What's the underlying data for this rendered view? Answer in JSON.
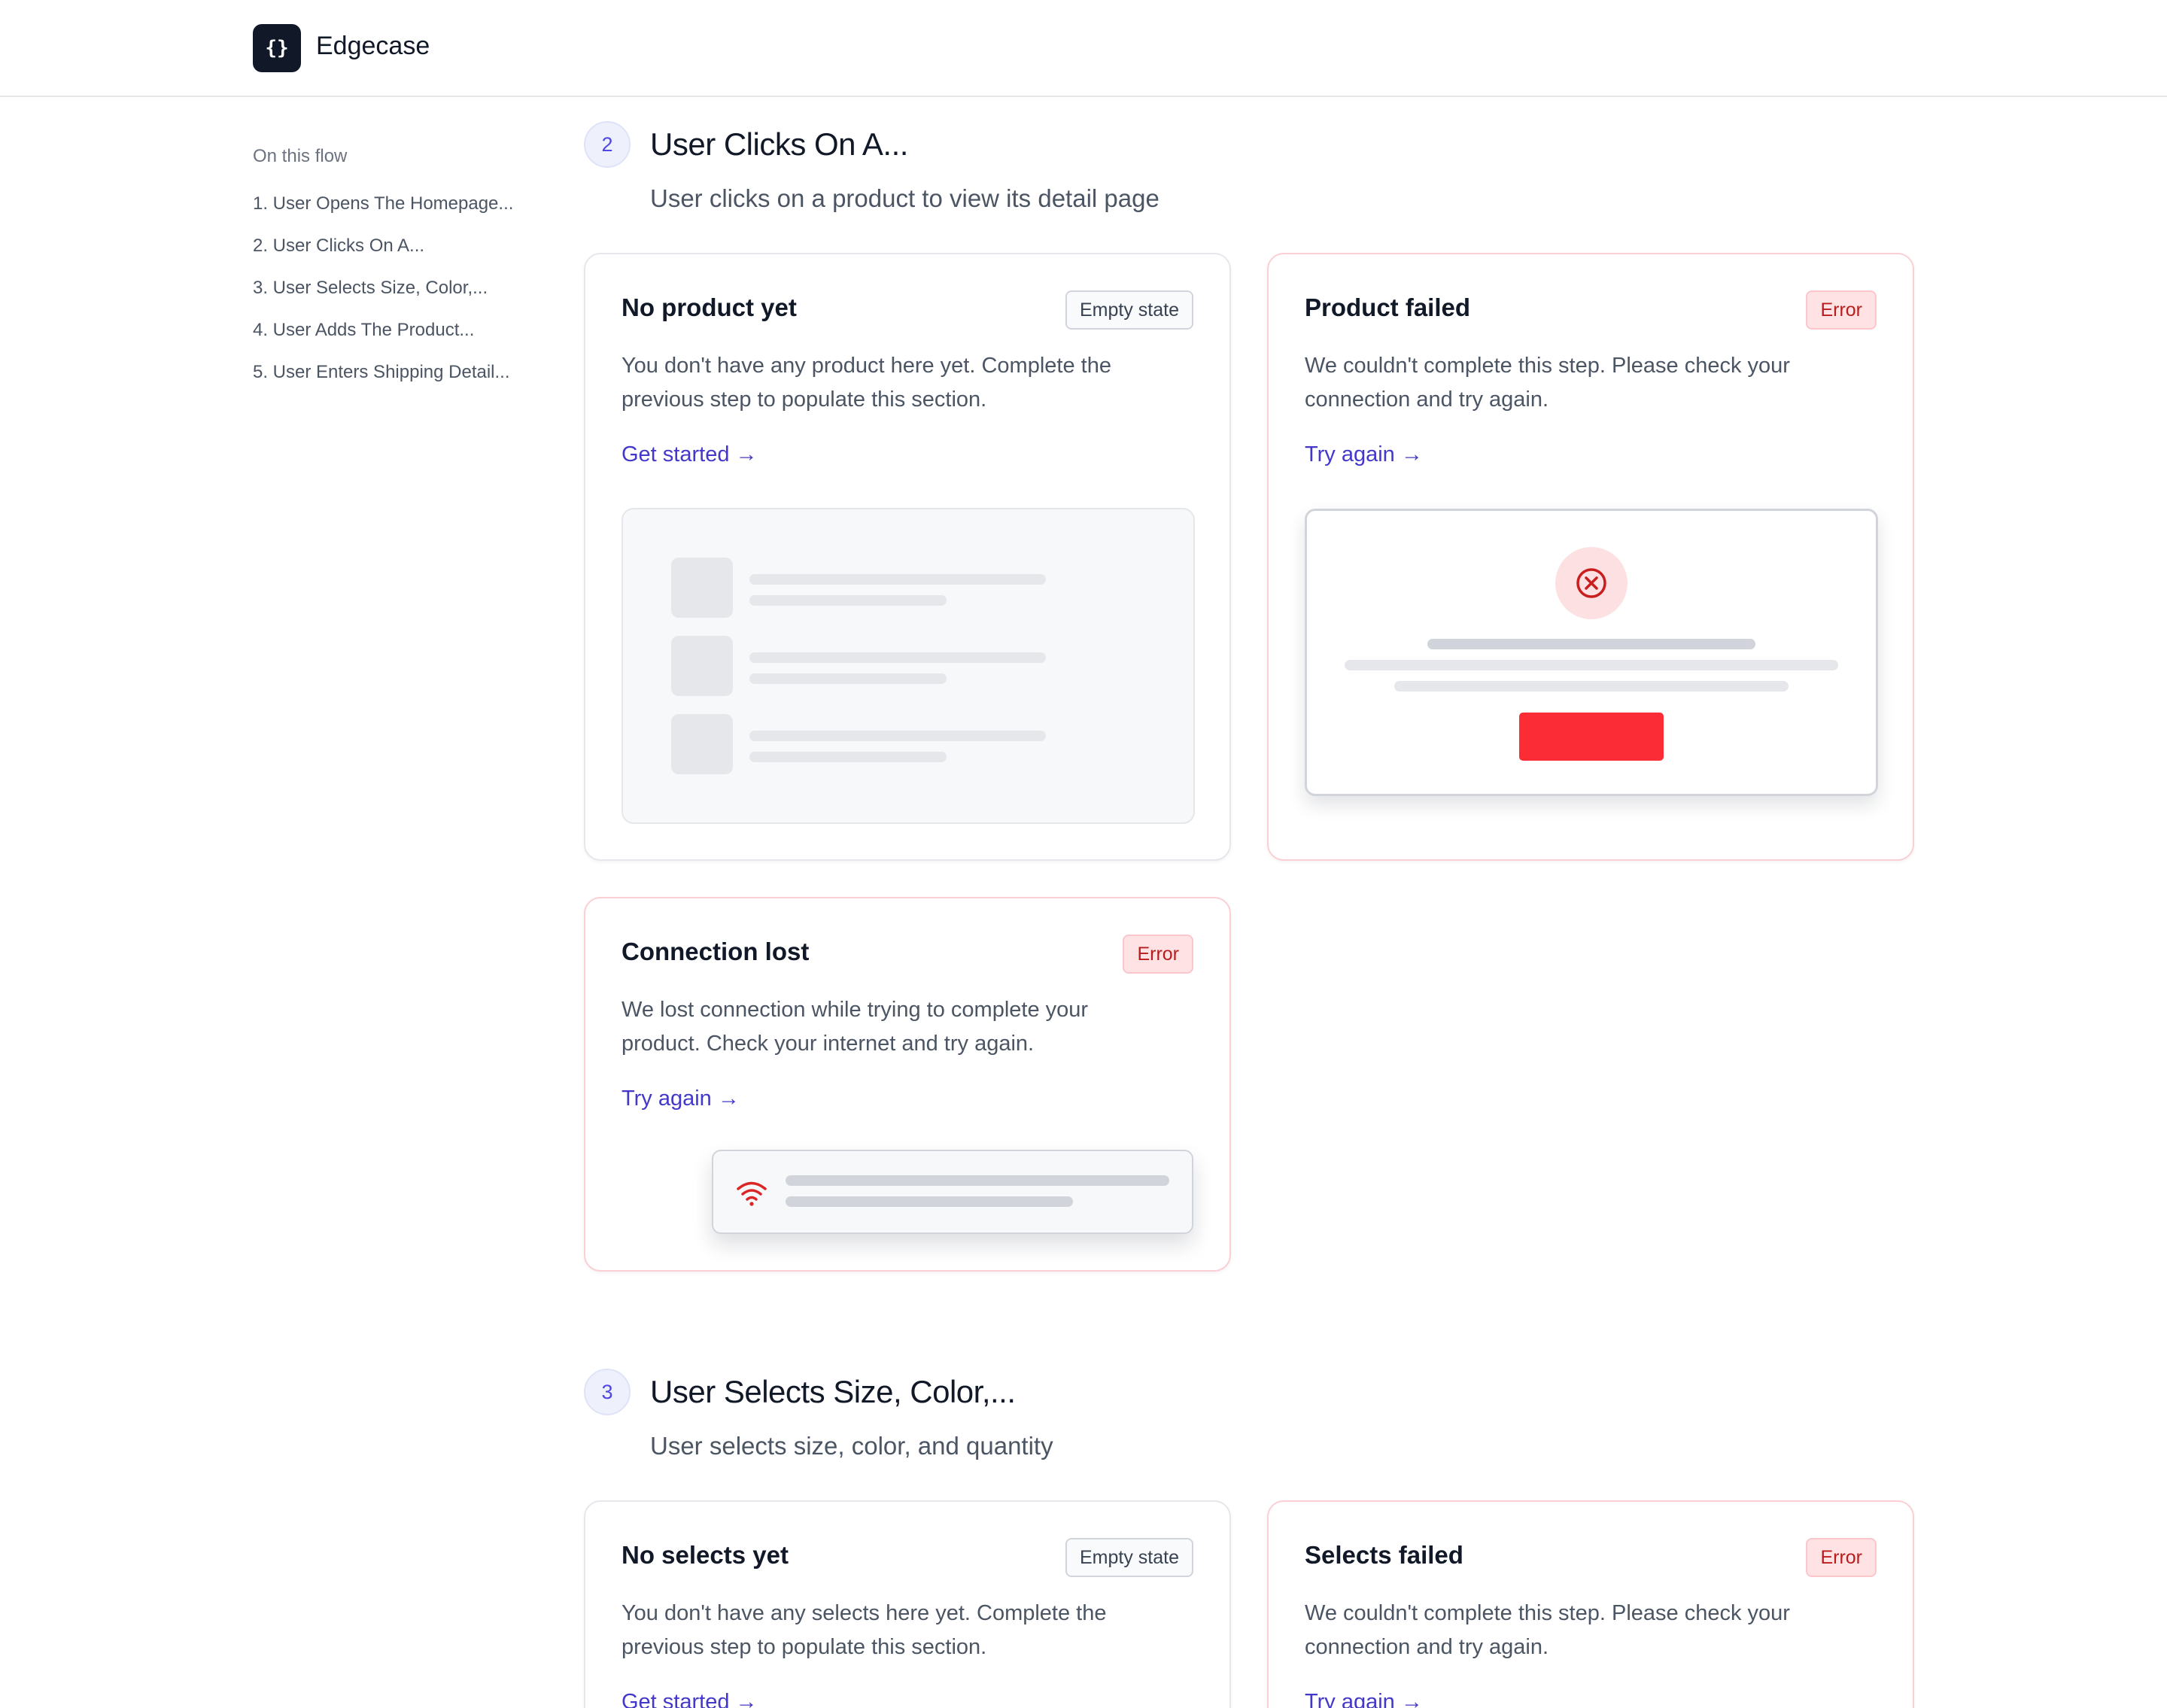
{
  "header": {
    "logo_glyph": "{}",
    "brand": "Edgecase"
  },
  "toc": {
    "title": "On this flow",
    "items": [
      "1. User Opens The Homepage...",
      "2. User Clicks On A...",
      "3. User Selects Size, Color,...",
      "4. User Adds The Product...",
      "5. User Enters Shipping Detail..."
    ]
  },
  "sections": [
    {
      "number": "2",
      "title": "User Clicks On A...",
      "description": "User clicks on a product to view its detail page",
      "cards": [
        {
          "title": "No product yet",
          "badge": "Empty state",
          "body": "You don't have any product here yet. Complete the previous step to populate this section.",
          "link": "Get started →",
          "illustration": "empty-list"
        },
        {
          "title": "Product failed",
          "badge": "Error",
          "body": "We couldn't complete this step. Please check your connection and try again.",
          "link": "Try again →",
          "illustration": "error-dialog"
        },
        {
          "title": "Connection lost",
          "badge": "Error",
          "body": "We lost connection while trying to complete your product. Check your internet and try again.",
          "link": "Try again →",
          "illustration": "offline-toast"
        }
      ]
    },
    {
      "number": "3",
      "title": "User Selects Size, Color,...",
      "description": "User selects size, color, and quantity",
      "cards": [
        {
          "title": "No selects yet",
          "badge": "Empty state",
          "body": "You don't have any selects here yet. Complete the previous step to populate this section.",
          "link": "Get started →"
        },
        {
          "title": "Selects failed",
          "badge": "Error",
          "body": "We couldn't complete this step. Please check your connection and try again.",
          "link": "Try again →"
        }
      ]
    }
  ],
  "colors": {
    "accent": "#4338ca",
    "error": "#fb2c36",
    "error_badge_text": "#b91c1c",
    "error_border": "#fbcfd4"
  },
  "icons": {
    "error": "x-circle-icon",
    "offline": "wifi-icon"
  }
}
